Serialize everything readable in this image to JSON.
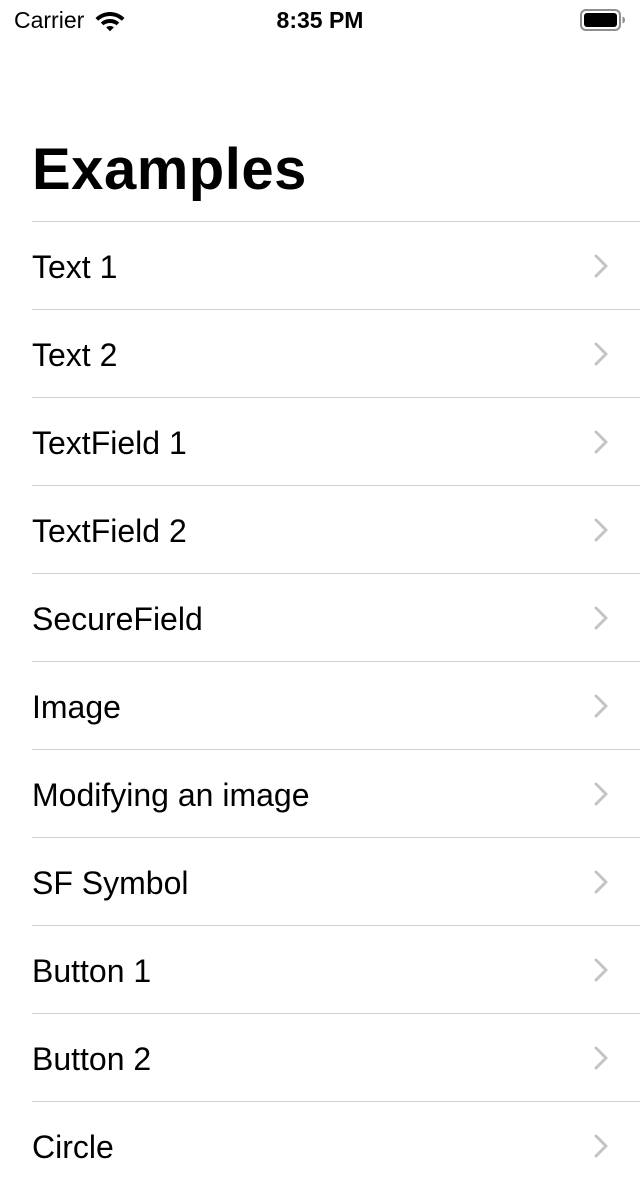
{
  "status_bar": {
    "carrier": "Carrier",
    "time": "8:35 PM",
    "icons": [
      "wifi-icon",
      "battery-icon"
    ]
  },
  "nav": {
    "title": "Examples"
  },
  "list": {
    "chevron_icon": "chevron-right-icon",
    "items": [
      {
        "label": "Text 1"
      },
      {
        "label": "Text 2"
      },
      {
        "label": "TextField 1"
      },
      {
        "label": "TextField 2"
      },
      {
        "label": "SecureField"
      },
      {
        "label": "Image"
      },
      {
        "label": "Modifying an image"
      },
      {
        "label": "SF Symbol"
      },
      {
        "label": "Button 1"
      },
      {
        "label": "Button 2"
      },
      {
        "label": "Circle"
      }
    ]
  },
  "colors": {
    "background": "#ffffff",
    "text": "#000000",
    "separator": "#d1d1d6",
    "chevron": "#c4c4c7"
  }
}
